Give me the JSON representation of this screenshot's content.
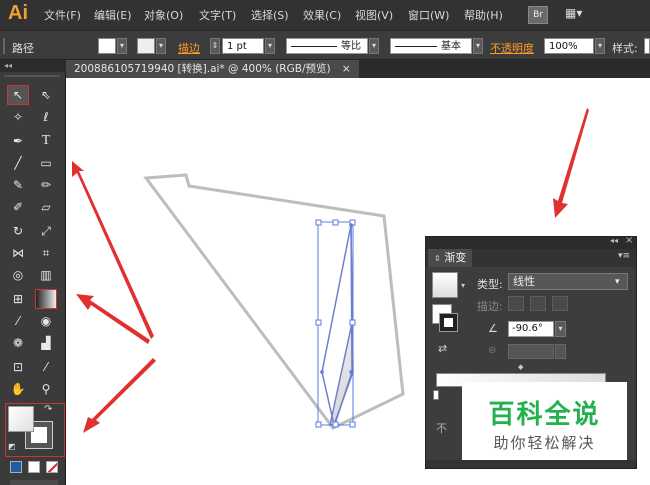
{
  "app": {
    "logo": "Ai"
  },
  "menu": [
    "文件(F)",
    "编辑(E)",
    "对象(O)",
    "文字(T)",
    "选择(S)",
    "效果(C)",
    "视图(V)",
    "窗口(W)",
    "帮助(H)"
  ],
  "menu_right": {
    "bridge": "Br",
    "workspace_glyph": "▦▾"
  },
  "control": {
    "object_type": "路径",
    "stroke_label": "描边",
    "stroke_weight": "1 pt",
    "profile_label": "等比",
    "brush_label": "基本",
    "opacity_label": "不透明度",
    "opacity_value": "100%",
    "style_label": "样式:"
  },
  "document": {
    "tab_title": "200886105719940 [转换].ai* @ 400% (RGB/预览)",
    "tab_close": "×"
  },
  "gradient_panel": {
    "tab_label": "渐变",
    "type_label": "类型:",
    "type_value": "线性",
    "stroke_label": "描边:",
    "angle_value": "-90.6°",
    "cut_text": "不"
  },
  "watermark": {
    "title": "百科全说",
    "subtitle": "助你轻松解决"
  },
  "colors": {
    "annotation_red": "#e03030",
    "selection_blue": "#3355ff",
    "accent_orange": "#ff9a2a"
  }
}
